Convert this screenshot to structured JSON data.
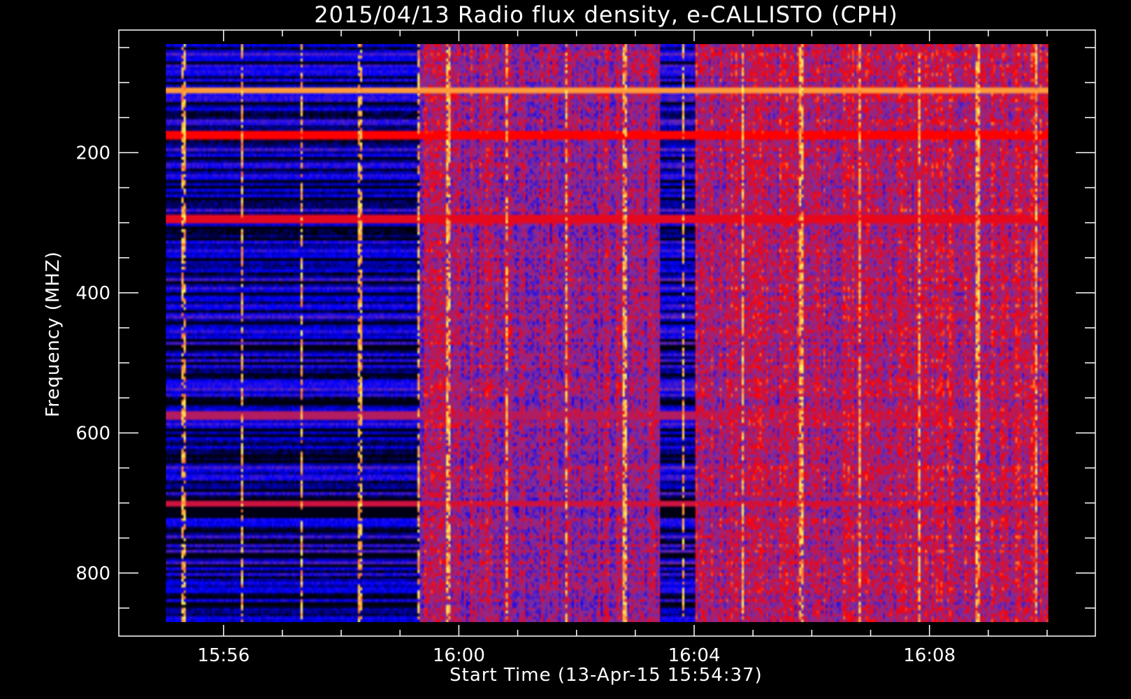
{
  "chart_data": {
    "type": "heatmap",
    "title": "2015/04/13  Radio flux density, e-CALLISTO (CPH)",
    "xlabel": "Start Time (13-Apr-15 15:54:37)",
    "ylabel": "Frequency (MHZ)",
    "x_unit": "minutes since 15:54:37",
    "x_data_range": [
      0.4,
      15.4
    ],
    "xlim": [
      -0.4,
      16.2
    ],
    "x_major_ticks": [
      {
        "value": 1.38,
        "label": "15:56"
      },
      {
        "value": 5.38,
        "label": "16:00"
      },
      {
        "value": 9.38,
        "label": "16:04"
      },
      {
        "value": 13.38,
        "label": "16:08"
      }
    ],
    "x_minor_step": 1,
    "y_data_range": [
      45,
      870
    ],
    "ylim": [
      890,
      25
    ],
    "y_major_ticks": [
      {
        "value": 200,
        "label": "200"
      },
      {
        "value": 400,
        "label": "400"
      },
      {
        "value": 600,
        "label": "600"
      },
      {
        "value": 800,
        "label": "800"
      }
    ],
    "y_minor_step": 50,
    "colormap": [
      "#000000",
      "#0000ff",
      "#7f2fa0",
      "#ff0000",
      "#ffff60"
    ],
    "segments": [
      {
        "x_start": 0.4,
        "x_end": 4.7,
        "state": "calibration",
        "base_level": 0.15
      },
      {
        "x_start": 4.7,
        "x_end": 8.8,
        "state": "observation",
        "base_level": 0.55
      },
      {
        "x_start": 8.8,
        "x_end": 9.4,
        "state": "calibration",
        "base_level": 0.2
      },
      {
        "x_start": 9.4,
        "x_end": 15.4,
        "state": "observation",
        "base_level": 0.6
      }
    ],
    "horizontal_bands": [
      {
        "freq": 110,
        "level": 0.9
      },
      {
        "freq": 175,
        "level": 0.75
      },
      {
        "freq": 295,
        "level": 0.7
      },
      {
        "freq": 700,
        "level": 0.65
      },
      {
        "freq": 575,
        "level": 0.6
      }
    ],
    "vertical_lines": [
      0.7,
      1.7,
      2.7,
      3.7,
      4.7,
      5.2,
      6.2,
      7.2,
      8.2,
      9.2,
      10.2,
      11.2,
      12.2,
      13.2,
      14.2,
      15.2
    ],
    "grid": false
  }
}
